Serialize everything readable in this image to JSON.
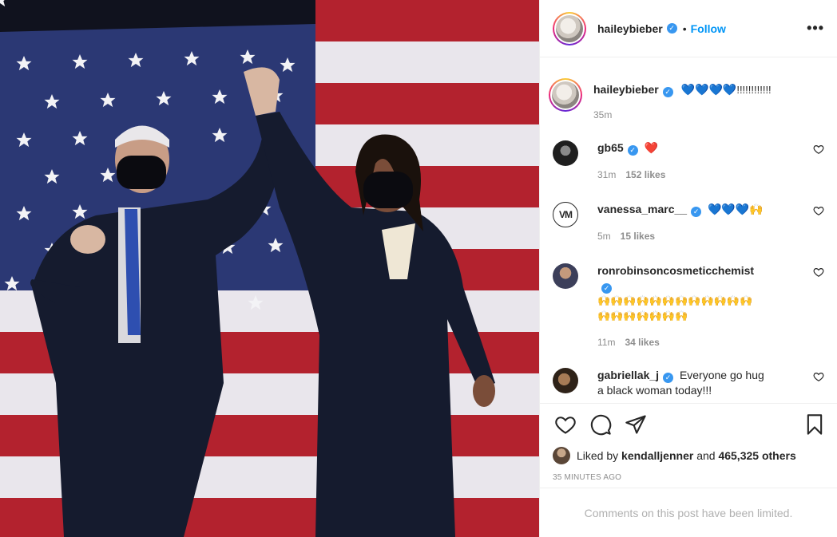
{
  "post_author": {
    "username": "haileybieber",
    "follow_label": "Follow",
    "separator": "•",
    "more_label": "•••"
  },
  "caption": {
    "username": "haileybieber",
    "text_emoji": "💙💙💙💙",
    "text_tail": "!!!!!!!!!!!!",
    "time": "35m"
  },
  "comments": [
    {
      "username": "gb65",
      "text": "❤️",
      "time": "31m",
      "likes": "152 likes",
      "avatar_color": "#2a2a2a"
    },
    {
      "username": "vanessa_marc__",
      "text": "💙💙💙🙌",
      "time": "5m",
      "likes": "15 likes",
      "avatar_text": "VM"
    },
    {
      "username": "ronrobinsoncosmeticchemist",
      "text": "🙌🙌🙌🙌🙌🙌🙌🙌🙌🙌🙌🙌🙌🙌🙌🙌🙌🙌🙌",
      "time": "11m",
      "likes": "34 likes"
    },
    {
      "username": "gabriellak_j",
      "text": "Everyone go hug a black woman today!!!"
    }
  ],
  "likes": {
    "prefix": "Liked by",
    "user": "kendalljenner",
    "connector": "and",
    "count": "465,325 others"
  },
  "time_ago": "35 MINUTES AGO",
  "limited_notice": "Comments on this post have been limited.",
  "colors": {
    "accent": "#0095f6",
    "verified": "#3897f0",
    "muted": "#8e8e8e",
    "heart_red": "#ed4956",
    "heart_blue": "#1f7ae0"
  },
  "icons": [
    "verified-badge-icon",
    "heart-icon",
    "comment-icon",
    "share-icon",
    "bookmark-icon",
    "more-icon"
  ]
}
